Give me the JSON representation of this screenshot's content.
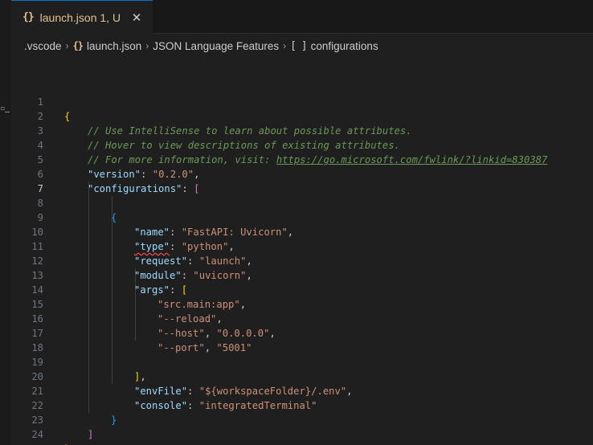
{
  "tab": {
    "icon": "json-braces-icon",
    "icon_text": "{}",
    "label": "launch.json",
    "badge": "1, U",
    "close_glyph": "✕"
  },
  "breadcrumb": {
    "items": [
      {
        "label": ".vscode"
      },
      {
        "label": "launch.json",
        "icon_text": "{}"
      },
      {
        "label": "JSON Language Features"
      },
      {
        "label": "configurations",
        "icon_text": "[ ]"
      }
    ],
    "separator": "›"
  },
  "editor": {
    "lines": [
      {
        "n": "1",
        "text": "{"
      },
      {
        "n": "2",
        "text": "// Use IntelliSense to learn about possible attributes."
      },
      {
        "n": "3",
        "text": "// Hover to view descriptions of existing attributes."
      },
      {
        "n": "4",
        "comment_prefix": "// For more information, visit: ",
        "link": "https://go.microsoft.com/fwlink/?linkid=830387"
      },
      {
        "n": "5",
        "key": "\"version\"",
        "value": "\"0.2.0\"",
        "tail": ","
      },
      {
        "n": "6",
        "key": "\"configurations\"",
        "bracket": "["
      },
      {
        "n": "7",
        "text": ""
      },
      {
        "n": "8",
        "text": "{"
      },
      {
        "n": "9",
        "key": "\"name\"",
        "value": "\"FastAPI: Uvicorn\"",
        "tail": ","
      },
      {
        "n": "10",
        "key": "\"type\"",
        "value": "\"python\"",
        "tail": ","
      },
      {
        "n": "11",
        "key": "\"request\"",
        "value": "\"launch\"",
        "tail": ","
      },
      {
        "n": "12",
        "key": "\"module\"",
        "value": "\"uvicorn\"",
        "tail": ","
      },
      {
        "n": "13",
        "key": "\"args\"",
        "bracket": "["
      },
      {
        "n": "14",
        "value": "\"src.main:app\"",
        "tail": ","
      },
      {
        "n": "15",
        "value": "\"--reload\"",
        "tail": ","
      },
      {
        "n": "16",
        "value": "\"--host\"",
        "tail": ",",
        "value2": "\"0.0.0.0\"",
        "tail2": ","
      },
      {
        "n": "17",
        "value": "\"--port\"",
        "tail": ",",
        "value2": "\"5001\""
      },
      {
        "n": "18",
        "text": ""
      },
      {
        "n": "19",
        "bracket": "]",
        "tail": ","
      },
      {
        "n": "20",
        "key": "\"envFile\"",
        "value": "\"${workspaceFolder}/.env\"",
        "tail": ","
      },
      {
        "n": "21",
        "key": "\"console\"",
        "value": "\"integratedTerminal\""
      },
      {
        "n": "22",
        "text": "}"
      },
      {
        "n": "23",
        "text": "]"
      },
      {
        "n": "24",
        "text": "}"
      }
    ]
  },
  "colors": {
    "background": "#1f1f1f",
    "accent": "#0078d4",
    "modified_file": "#e2c08d",
    "json_key": "#9cdcfe",
    "json_string": "#ce9178",
    "comment": "#6a9955",
    "bracket_level_1": "#ffd700",
    "bracket_level_2": "#da70d6",
    "bracket_level_3": "#179fff",
    "error_squiggle": "#f14c4c"
  }
}
